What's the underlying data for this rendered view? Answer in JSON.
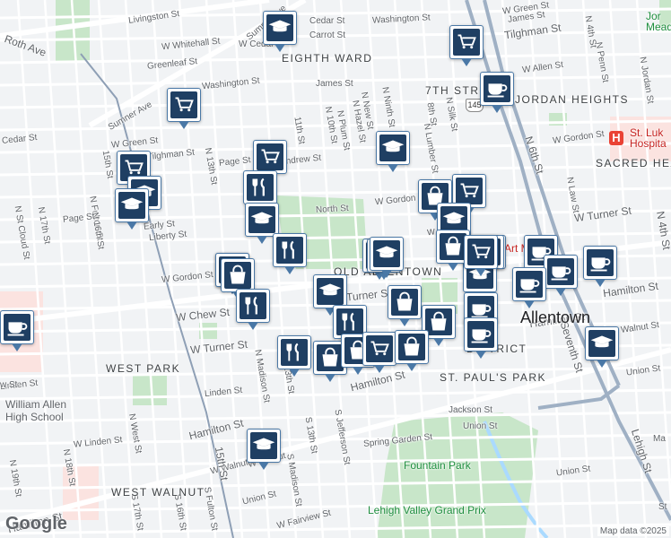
{
  "map": {
    "colors": {
      "road": "#ffffff",
      "arterial": "#8e9fb5",
      "highway": "#7f93ad",
      "park": "#c8e6c9",
      "poi_pin": "#1f3f63",
      "water": "#aadaff"
    },
    "streets": [
      {
        "id": "livingston",
        "text": "Livingston St"
      },
      {
        "id": "whitehall",
        "text": "W Whitehall St"
      },
      {
        "id": "roth-ave",
        "text": "Roth Ave"
      },
      {
        "id": "greenleaf",
        "text": "Greenleaf St"
      },
      {
        "id": "cedar-st-n",
        "text": "Cedar St"
      },
      {
        "id": "carrot",
        "text": "Carrot St"
      },
      {
        "id": "washington-e",
        "text": "Washington St"
      },
      {
        "id": "washington-w",
        "text": "Washington St"
      },
      {
        "id": "w-cedar",
        "text": "W Cedar"
      },
      {
        "id": "sumner-ave-top",
        "text": "Sumner Ave"
      },
      {
        "id": "sumner-ave",
        "text": "Sumner Ave"
      },
      {
        "id": "james-st",
        "text": "James St"
      },
      {
        "id": "cedar-st-w",
        "text": "Cedar St"
      },
      {
        "id": "w-green",
        "text": "W Green St"
      },
      {
        "id": "w-tilghman",
        "text": "W Tilghman St"
      },
      {
        "id": "page-st",
        "text": "Page St"
      },
      {
        "id": "andrew",
        "text": "Andrew St"
      },
      {
        "id": "n-11th",
        "text": "11th St"
      },
      {
        "id": "n-10th",
        "text": "N 10th St"
      },
      {
        "id": "n-plum",
        "text": "N Plum St"
      },
      {
        "id": "n-hazel",
        "text": "N Hazel St"
      },
      {
        "id": "n-new",
        "text": "N New St"
      },
      {
        "id": "n-ninth",
        "text": "N Ninth St"
      },
      {
        "id": "n-lumber",
        "text": "N Lumber St"
      },
      {
        "id": "n-silk",
        "text": "N Silk St"
      },
      {
        "id": "eighth-st",
        "text": "8th St"
      },
      {
        "id": "n-13th",
        "text": "N 13th St"
      },
      {
        "id": "n-15th",
        "text": "15th St"
      },
      {
        "id": "n-fulton",
        "text": "N Fulton St"
      },
      {
        "id": "n-16th",
        "text": "N 16th St"
      },
      {
        "id": "n-17th",
        "text": "N 17th St"
      },
      {
        "id": "st-cloud",
        "text": "N St Cloud St"
      },
      {
        "id": "page-st-w",
        "text": "Page St"
      },
      {
        "id": "early",
        "text": "Early St"
      },
      {
        "id": "liberty",
        "text": "Liberty St"
      },
      {
        "id": "north-st",
        "text": "North St"
      },
      {
        "id": "w-gordon-e",
        "text": "W Gordon"
      },
      {
        "id": "w-gordon-w",
        "text": "W Gordon St"
      },
      {
        "id": "w-chew",
        "text": "W Chew St"
      },
      {
        "id": "w-turner",
        "text": "W Turner St"
      },
      {
        "id": "turner-st",
        "text": "Turner St"
      },
      {
        "id": "w-st",
        "text": "w St"
      },
      {
        "id": "linden",
        "text": "Linden St"
      },
      {
        "id": "n-madison",
        "text": "N Madison St"
      },
      {
        "id": "n-13th-s",
        "text": "13th St"
      },
      {
        "id": "hamilton-st",
        "text": "Hamilton St"
      },
      {
        "id": "hamilton-w",
        "text": "Hamilton St"
      },
      {
        "id": "hamilton-far",
        "text": "Hamilton St"
      },
      {
        "id": "hamilton-e",
        "text": "Hamilton St"
      },
      {
        "id": "n-west",
        "text": "N West St"
      },
      {
        "id": "linden-w",
        "text": "Linden St"
      },
      {
        "id": "w-linden",
        "text": "W Linden St"
      },
      {
        "id": "n-19th",
        "text": "N 19th St"
      },
      {
        "id": "n-18th",
        "text": "N 18th St"
      },
      {
        "id": "w-walnut",
        "text": "W Walnut St"
      },
      {
        "id": "w-walnut-w",
        "text": "W Walnut"
      },
      {
        "id": "s-madison",
        "text": "S Madison St"
      },
      {
        "id": "s-13th",
        "text": "S 13th St"
      },
      {
        "id": "s-jefferson",
        "text": "S Jefferson St"
      },
      {
        "id": "spring-garden",
        "text": "Spring Garden St"
      },
      {
        "id": "jackson",
        "text": "Jackson St"
      },
      {
        "id": "union-st",
        "text": "Union St"
      },
      {
        "id": "union-w",
        "text": "Union St"
      },
      {
        "id": "union-e",
        "text": "Union St"
      },
      {
        "id": "s-17th",
        "text": "S 17th St"
      },
      {
        "id": "s-16th",
        "text": "S 16th St"
      },
      {
        "id": "s-fulton",
        "text": "S Fulton St"
      },
      {
        "id": "w-fairview",
        "text": "W Fairview St"
      },
      {
        "id": "fifteenth",
        "text": "15th St"
      },
      {
        "id": "n-6th",
        "text": "N 6th St"
      },
      {
        "id": "seventh",
        "text": "Seventh St"
      },
      {
        "id": "n-penn",
        "text": "N Penn St"
      },
      {
        "id": "n-4th",
        "text": "N 4th St"
      },
      {
        "id": "n-4th-s",
        "text": "N 4th St"
      },
      {
        "id": "n-jordan",
        "text": "N Jordan St"
      },
      {
        "id": "w-allen",
        "text": "W Allen St"
      },
      {
        "id": "tilghman",
        "text": "Tilghman St"
      },
      {
        "id": "w-green-e",
        "text": "W Green St"
      },
      {
        "id": "james-e",
        "text": "James St"
      },
      {
        "id": "w-gordon-far",
        "text": "W Gordon St"
      },
      {
        "id": "n-law",
        "text": "N Law St"
      },
      {
        "id": "w-turner-e",
        "text": "W Turner St"
      },
      {
        "id": "hamilton-st-e",
        "text": "Hamilton St"
      },
      {
        "id": "walnut-e",
        "text": "Walnut St"
      },
      {
        "id": "lehigh",
        "text": "Lehigh St"
      },
      {
        "id": "union-far",
        "text": "Union St"
      },
      {
        "id": "ma",
        "text": "Ma"
      },
      {
        "id": "s-st",
        "text": "St"
      },
      {
        "id": "w-st-far",
        "text": "w St"
      }
    ],
    "neighborhoods": [
      {
        "id": "eighth-ward",
        "text": "EIGHTH WARD"
      },
      {
        "id": "7th-street",
        "text": "7TH STR"
      },
      {
        "id": "jordan-heights",
        "text": "JORDAN HEIGHTS"
      },
      {
        "id": "sacred-heart",
        "text": "SACRED HEA"
      },
      {
        "id": "old-allentown",
        "text": "OLD ALLENTOWN"
      },
      {
        "id": "west-park",
        "text": "WEST PARK"
      },
      {
        "id": "st-pauls-park",
        "text": "ST. PAUL'S PARK"
      },
      {
        "id": "west-walnut",
        "text": "WEST WALNUT"
      },
      {
        "id": "district",
        "text": "DISTRICT"
      }
    ],
    "city": "Allentown",
    "pois": [
      {
        "id": "william-allen",
        "text": "William Allen\nHigh School",
        "kind": "gray"
      },
      {
        "id": "st-lukes",
        "text": "St. Luk\nHospita",
        "kind": "red"
      },
      {
        "id": "fountain-park",
        "text": "Fountain Park",
        "kind": "green"
      },
      {
        "id": "grand-prix",
        "text": "Lehigh Valley Grand Prix",
        "kind": "green"
      },
      {
        "id": "jordan-mead",
        "text": "Jor\nMead",
        "kind": "green"
      },
      {
        "id": "art-museum",
        "text": "Art M",
        "kind": "red"
      }
    ],
    "route_shield": "145",
    "markers": [
      {
        "icon": "school"
      },
      {
        "icon": "cart"
      },
      {
        "icon": "cart"
      },
      {
        "icon": "coffee"
      },
      {
        "icon": "school"
      },
      {
        "icon": "cart"
      },
      {
        "icon": "cart"
      },
      {
        "icon": "cart"
      },
      {
        "icon": "school"
      },
      {
        "icon": "school"
      },
      {
        "icon": "utensils"
      },
      {
        "icon": "school"
      },
      {
        "icon": "utensils"
      },
      {
        "icon": "bag"
      },
      {
        "icon": "bag"
      },
      {
        "icon": "cart"
      },
      {
        "icon": "school"
      },
      {
        "icon": "bag"
      },
      {
        "icon": "cart"
      },
      {
        "icon": "school"
      },
      {
        "icon": "bag"
      },
      {
        "icon": "cart"
      },
      {
        "icon": "coffee"
      },
      {
        "icon": "coffee"
      },
      {
        "icon": "coffee"
      },
      {
        "icon": "coffee"
      },
      {
        "icon": "school"
      },
      {
        "icon": "utensils"
      },
      {
        "icon": "school"
      },
      {
        "icon": "bag"
      },
      {
        "icon": "utensils"
      },
      {
        "icon": "bag"
      },
      {
        "icon": "bag"
      },
      {
        "icon": "utensils"
      },
      {
        "icon": "coffee"
      },
      {
        "icon": "coffee"
      },
      {
        "icon": "utensils"
      },
      {
        "icon": "bag"
      },
      {
        "icon": "bag"
      },
      {
        "icon": "cart"
      },
      {
        "icon": "bag"
      },
      {
        "icon": "school"
      },
      {
        "icon": "school"
      },
      {
        "icon": "coffee"
      },
      {
        "icon": "school"
      }
    ],
    "logo": "Google",
    "attribution": "Map data ©2025"
  }
}
